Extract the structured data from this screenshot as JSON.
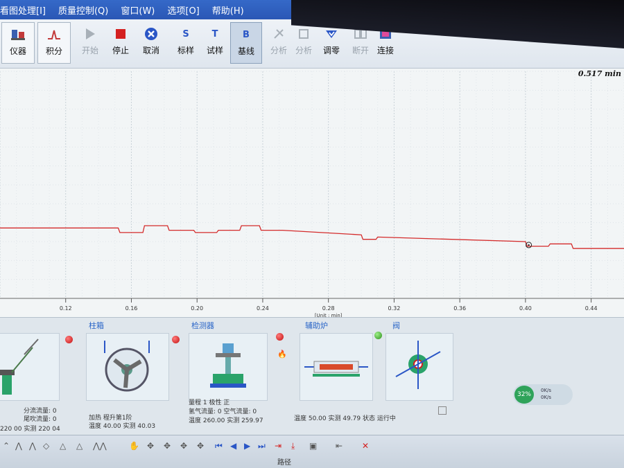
{
  "menu": [
    "看图处理[I]",
    "质量控制(Q)",
    "窗口(W)",
    "选项[O]",
    "帮助(H)"
  ],
  "toolbar": {
    "items": [
      {
        "label": "仪器",
        "icon": "instrument-icon"
      },
      {
        "label": "积分",
        "icon": "integrate-icon"
      },
      {
        "label": "开始",
        "icon": "play-icon"
      },
      {
        "label": "停止",
        "icon": "stop-icon"
      },
      {
        "label": "取消",
        "icon": "cancel-icon"
      },
      {
        "label": "标样",
        "icon": "standard-sample-icon",
        "glyph": "S"
      },
      {
        "label": "试样",
        "icon": "test-sample-icon",
        "glyph": "T"
      },
      {
        "label": "基线",
        "icon": "baseline-icon",
        "glyph": "B"
      },
      {
        "label": "分析",
        "icon": "analyze-icon"
      },
      {
        "label": "分析",
        "icon": "analyze2-icon"
      },
      {
        "label": "调零",
        "icon": "zero-icon"
      },
      {
        "label": "断开",
        "icon": "disconnect-icon"
      },
      {
        "label": "连接",
        "icon": "connect-icon"
      }
    ]
  },
  "chart": {
    "readout": "0.517 min",
    "unit_label": "[Unit : min]",
    "line_color": "#d42a2a"
  },
  "chart_data": {
    "type": "line",
    "x_ticks": [
      "0.12",
      "0.16",
      "0.20",
      "0.24",
      "0.28",
      "0.32",
      "0.36",
      "0.40",
      "0.44"
    ],
    "xlabel": "[Unit : min]",
    "xlim": [
      0.08,
      0.46
    ],
    "ylim": [
      0,
      1
    ],
    "grid": true,
    "series": [
      {
        "points": [
          [
            0.08,
            0.31
          ],
          [
            0.152,
            0.31
          ],
          [
            0.153,
            0.29
          ],
          [
            0.167,
            0.29
          ],
          [
            0.168,
            0.32
          ],
          [
            0.182,
            0.32
          ],
          [
            0.183,
            0.3
          ],
          [
            0.198,
            0.3
          ],
          [
            0.199,
            0.29
          ],
          [
            0.212,
            0.29
          ],
          [
            0.213,
            0.3
          ],
          [
            0.226,
            0.3
          ],
          [
            0.227,
            0.32
          ],
          [
            0.238,
            0.32
          ],
          [
            0.239,
            0.3
          ],
          [
            0.252,
            0.3
          ],
          [
            0.3,
            0.28
          ],
          [
            0.301,
            0.26
          ],
          [
            0.309,
            0.26
          ],
          [
            0.31,
            0.27
          ],
          [
            0.4,
            0.25
          ],
          [
            0.401,
            0.23
          ],
          [
            0.414,
            0.23
          ],
          [
            0.415,
            0.24
          ],
          [
            0.428,
            0.24
          ],
          [
            0.429,
            0.22
          ],
          [
            0.46,
            0.22
          ]
        ]
      }
    ]
  },
  "panels": {
    "p1": {
      "info1": "分流流量: 0",
      "info2": "尾吹流量: 0",
      "info3": "220 00  实测  220 04"
    },
    "column": {
      "title": "柱箱",
      "info1": "加热    程升第1阶",
      "info2": "温度   40.00  实测  40.03"
    },
    "detector": {
      "title": "检测器",
      "info1": "量程      1     极性      正",
      "info2": "氢气流量: 0    空气流量: 0",
      "info3": "温度  260.00 实测  259.97"
    },
    "aux": {
      "title": "辅助炉",
      "info1": "温度  50.00  实测  49.79  状态  运行中"
    },
    "valve": {
      "title": "阀"
    }
  },
  "badge": {
    "percent": "32%",
    "net1": "0K/s",
    "net2": "0K/s"
  },
  "statusbar": {
    "text": "路径"
  }
}
